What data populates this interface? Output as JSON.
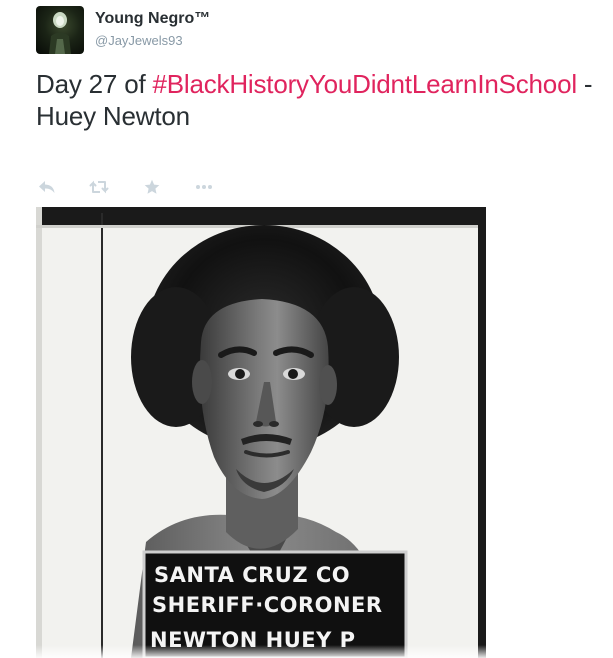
{
  "author": {
    "display_name": "Young Negro™",
    "screen_name": "@JayJewels93",
    "avatar_icon": "avatar-figure-icon"
  },
  "tweet": {
    "text_before": "Day 27 of ",
    "hashtag": "#BlackHistoryYouDidntLearnInSchool",
    "text_after": " - Huey Newton"
  },
  "actions": {
    "reply_icon": "reply-icon",
    "retweet_icon": "retweet-icon",
    "favorite_icon": "star-icon",
    "more_icon": "more-icon"
  },
  "media": {
    "placard_line1": "SANTA CRUZ CO",
    "placard_line2": "SHERIFF·CORONER",
    "placard_line3": "NEWTON HUEY P"
  },
  "colors": {
    "hashtag": "#e0245e",
    "text": "#292f33",
    "muted": "#8899a6",
    "action_icon": "#ccd6dd"
  }
}
